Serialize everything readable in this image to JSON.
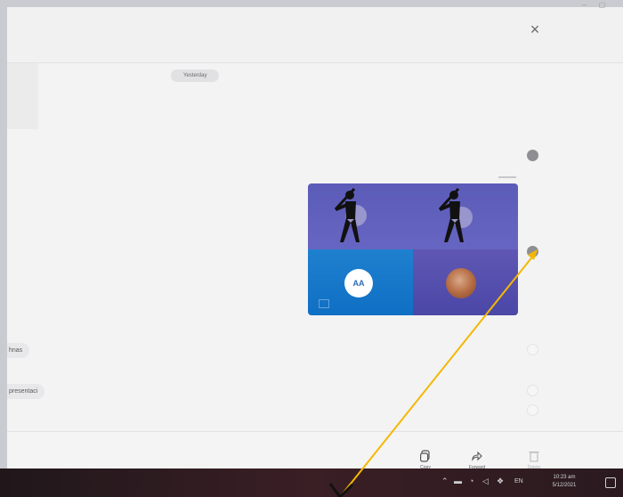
{
  "window": {
    "close_symbol": "×",
    "corner_mark": "– ▢"
  },
  "chat": {
    "date_divider": "Yesterday",
    "messages": [
      {
        "text": "hnas"
      },
      {
        "text": "presentaci"
      }
    ]
  },
  "tile": {
    "initials": "AA"
  },
  "bottombar": {
    "actions": [
      {
        "label": "Copy",
        "icon": "copy-icon"
      },
      {
        "label": "Forward",
        "icon": "forward-icon"
      },
      {
        "label": "Delete",
        "icon": "delete-icon"
      }
    ]
  },
  "taskbar": {
    "tray_icons": [
      "chevron-up-icon",
      "battery-icon",
      "network-icon",
      "volume-icon",
      "dropbox-icon",
      "language-icon"
    ],
    "language": "EN",
    "time": "10:23 am",
    "date": "5/12/2021"
  },
  "annotation": {
    "arrow_color": "#f5b800",
    "icon": "baseball-batter-icon"
  }
}
